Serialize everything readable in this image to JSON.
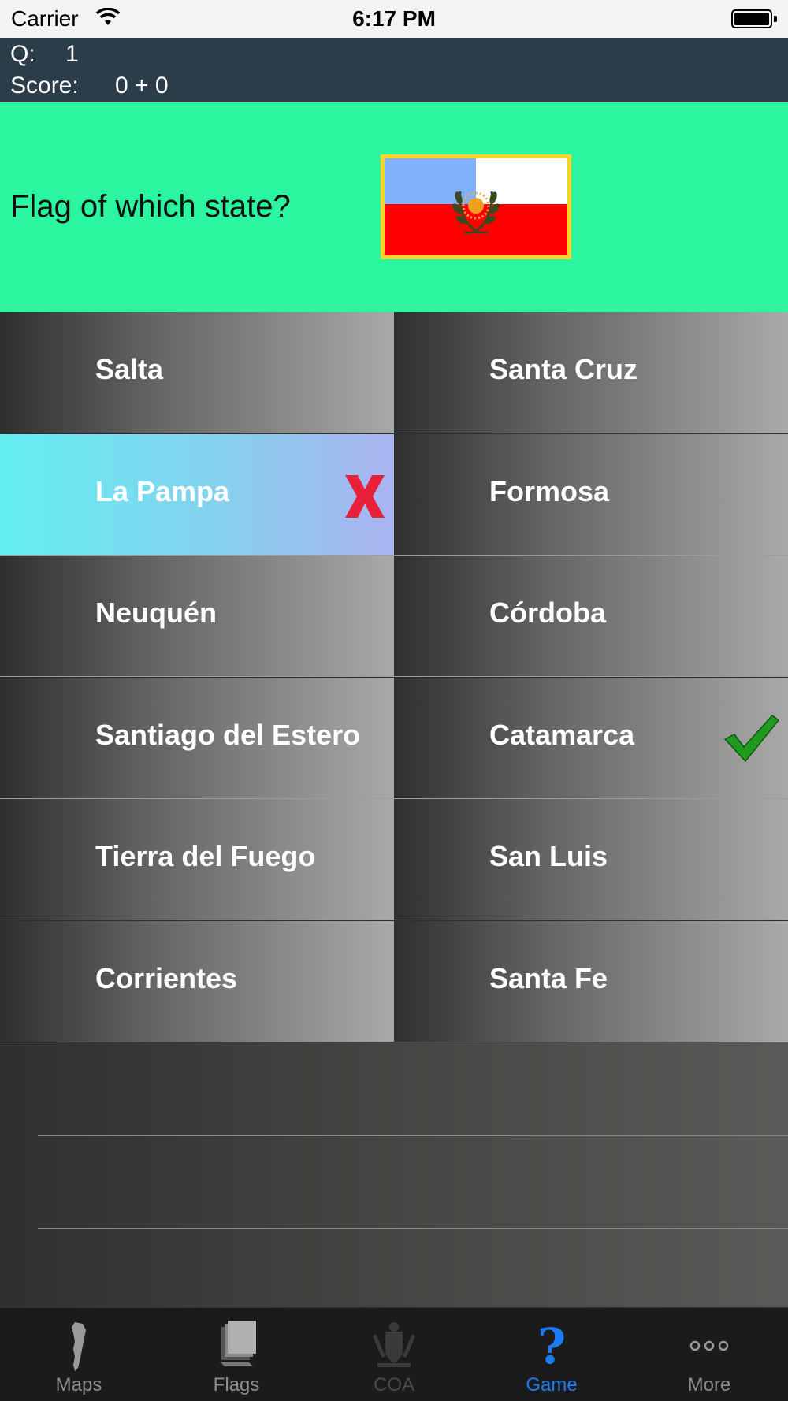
{
  "status_bar": {
    "carrier": "Carrier",
    "time": "6:17 PM",
    "icons": [
      "wifi-icon",
      "battery-icon"
    ]
  },
  "header": {
    "q_label": "Q:",
    "q_value": "1",
    "score_label": "Score:",
    "score_value": "0 + 0"
  },
  "question": {
    "text": "Flag of which state?",
    "flag_colors": {
      "top_left": "#80b0fa",
      "top_right": "#ffffff",
      "bottom": "#ff0000",
      "border": "#f5d52b"
    }
  },
  "answers": [
    {
      "label": "Salta",
      "state": "normal"
    },
    {
      "label": "Santa Cruz",
      "state": "normal"
    },
    {
      "label": "La Pampa",
      "state": "selected-wrong"
    },
    {
      "label": "Formosa",
      "state": "normal"
    },
    {
      "label": "Neuquén",
      "state": "normal"
    },
    {
      "label": "Córdoba",
      "state": "normal"
    },
    {
      "label": "Santiago del Estero",
      "state": "normal"
    },
    {
      "label": "Catamarca",
      "state": "correct"
    },
    {
      "label": "Tierra del Fuego",
      "state": "normal"
    },
    {
      "label": "San Luis",
      "state": "normal"
    },
    {
      "label": "Corrientes",
      "state": "normal"
    },
    {
      "label": "Santa Fe",
      "state": "normal"
    }
  ],
  "tab_bar": {
    "tabs": [
      {
        "label": "Maps",
        "icon": "map-icon",
        "state": "normal"
      },
      {
        "label": "Flags",
        "icon": "flags-icon",
        "state": "normal"
      },
      {
        "label": "COA",
        "icon": "coat-of-arms-icon",
        "state": "disabled"
      },
      {
        "label": "Game",
        "icon": "question-mark-icon",
        "state": "active"
      },
      {
        "label": "More",
        "icon": "more-icon",
        "state": "normal"
      }
    ]
  },
  "colors": {
    "header_bg": "#2b3d49",
    "question_bg": "#2cf5a0",
    "active_tab": "#1a7cf5",
    "wrong_mark": "#e8203a",
    "correct_mark": "#1f9a1f"
  }
}
